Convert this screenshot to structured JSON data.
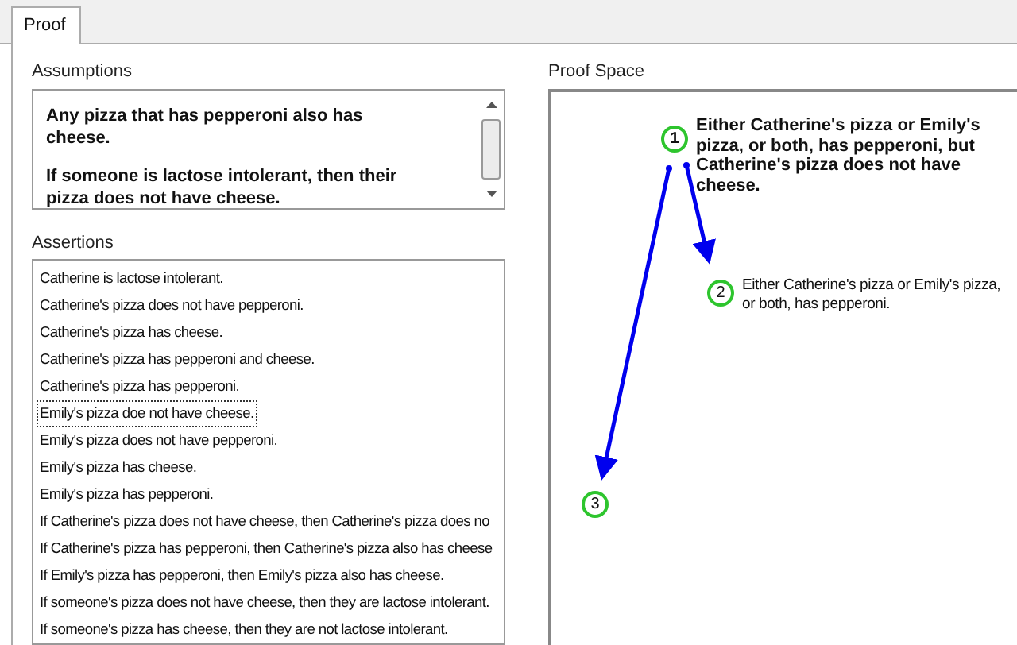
{
  "tabs": [
    {
      "label": "Proof",
      "selected": true
    }
  ],
  "assumptions": {
    "label": "Assumptions",
    "items": [
      "Any pizza that has pepperoni also has cheese.",
      "If someone is lactose intolerant, then their pizza does not have cheese."
    ]
  },
  "assertions": {
    "label": "Assertions",
    "items": [
      {
        "text": "Catherine is lactose intolerant.",
        "focused": false
      },
      {
        "text": "Catherine's pizza does not have pepperoni.",
        "focused": false
      },
      {
        "text": "Catherine's pizza has cheese.",
        "focused": false
      },
      {
        "text": "Catherine's pizza has pepperoni and cheese.",
        "focused": false
      },
      {
        "text": "Catherine's pizza has pepperoni.",
        "focused": false
      },
      {
        "text": "Emily's pizza doe not have cheese.",
        "focused": true
      },
      {
        "text": "Emily's pizza does not have pepperoni.",
        "focused": false
      },
      {
        "text": "Emily's pizza has cheese.",
        "focused": false
      },
      {
        "text": "Emily's pizza has pepperoni.",
        "focused": false
      },
      {
        "text": "If Catherine's pizza does not have cheese, then Catherine's pizza does no",
        "focused": false
      },
      {
        "text": "If Catherine's pizza has pepperoni, then Catherine's pizza also has cheese",
        "focused": false
      },
      {
        "text": "If Emily's pizza has pepperoni, then Emily's pizza also has cheese.",
        "focused": false
      },
      {
        "text": "If someone's pizza does not have cheese, then they are lactose intolerant.",
        "focused": false
      },
      {
        "text": "If someone's pizza has cheese, then they are not lactose intolerant.",
        "focused": false
      }
    ]
  },
  "proof_space": {
    "label": "Proof Space",
    "nodes": [
      {
        "number": "1",
        "text": "Either Catherine's pizza or Emily's pizza, or both, has pepperoni, but Catherine's pizza does not have cheese.",
        "kind": "goal"
      },
      {
        "number": "2",
        "text": "Either Catherine's pizza or Emily's pizza, or both, has pepperoni.",
        "kind": "step"
      },
      {
        "number": "3",
        "kind": "step"
      }
    ]
  }
}
